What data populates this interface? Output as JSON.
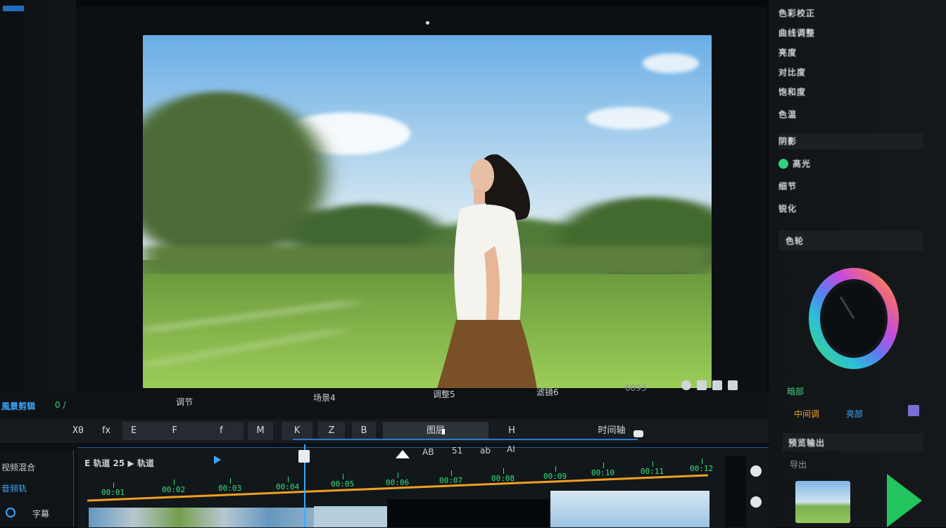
{
  "left_panel": {
    "title": "風景剪辑",
    "counter": "0 /"
  },
  "status_bar": {
    "items": [
      "调节",
      "场景4",
      "调整5",
      "滤镜6",
      "6093"
    ]
  },
  "tool_row": {
    "labels": [
      "X0",
      "fx",
      "E",
      "F",
      "f",
      "M",
      "K",
      "Z",
      "B",
      "图层",
      "H",
      "时间轴"
    ]
  },
  "timeline": {
    "left_labels": [
      "视频混合",
      "音频轨",
      "字幕"
    ],
    "header": "E 轨道 25 ▶ 轨道",
    "markers": [
      "00:01",
      "00:02",
      "00:03",
      "00:04",
      "00:05",
      "00:06",
      "00:07",
      "00:08",
      "00:09",
      "00:10",
      "00:11",
      "00:12"
    ],
    "center_icons": [
      "AB",
      "51",
      "ab",
      "AI"
    ]
  },
  "right_panel": {
    "rows": [
      "色彩校正",
      "曲线调整",
      "亮度",
      "对比度",
      "饱和度",
      "色温",
      "阴影",
      "高光",
      "细节",
      "锐化"
    ],
    "wheel_label": "色轮",
    "wheel_colors": [
      "#3fd27a",
      "#2ac1d9",
      "#5c7cf0",
      "#c44be0",
      "#f06a7a",
      "#f0a05a"
    ],
    "labels": [
      "暗部",
      "中间调",
      "亮部",
      "导出"
    ],
    "section_title": "预览输出"
  },
  "colors": {
    "accent_blue": "#1f6fc0",
    "marker_green": "#35e07a",
    "track_orange": "#f0a020",
    "play_green": "#22c55e"
  }
}
